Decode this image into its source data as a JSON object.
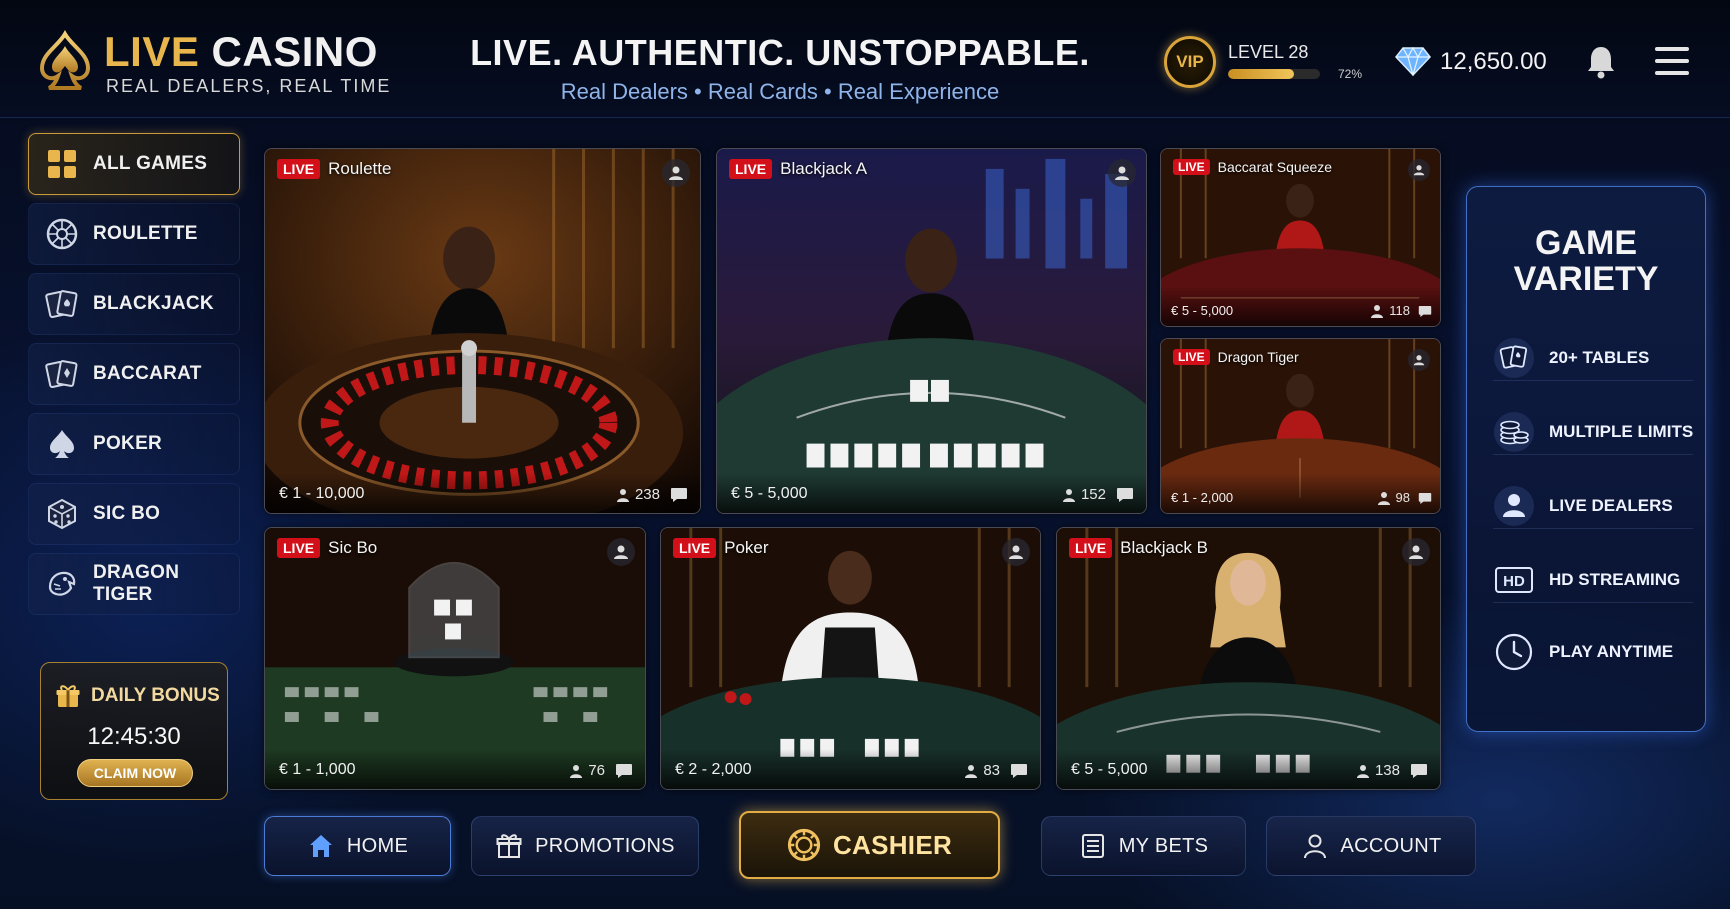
{
  "header": {
    "logo_title_gold": "LIVE",
    "logo_title_white": " CASINO",
    "logo_subtitle": "REAL DEALERS, REAL TIME",
    "tagline": "LIVE. AUTHENTIC. UNSTOPPABLE.",
    "subtagline": "Real Dealers • Real Cards • Real Experience",
    "vip_label": "VIP",
    "level_label": "LEVEL 28",
    "level_progress_pct": 72,
    "level_progress_text": "72%",
    "balance": "12,650.00"
  },
  "sidebar": {
    "items": [
      {
        "label": "ALL GAMES",
        "icon": "grid-icon",
        "active": true
      },
      {
        "label": "ROULETTE",
        "icon": "roulette-icon",
        "active": false
      },
      {
        "label": "BLACKJACK",
        "icon": "cards-icon",
        "active": false
      },
      {
        "label": "BACCARAT",
        "icon": "cards-icon",
        "active": false
      },
      {
        "label": "POKER",
        "icon": "spade-icon",
        "active": false
      },
      {
        "label": "SIC BO",
        "icon": "dice-icon",
        "active": false
      },
      {
        "label": "DRAGON TIGER",
        "icon": "dragon-icon",
        "active": false
      }
    ],
    "bonus": {
      "title": "DAILY BONUS",
      "timer": "12:45:30",
      "button": "CLAIM NOW"
    }
  },
  "games": [
    {
      "live": "LIVE",
      "title": "Roulette",
      "limits": "€ 1 - 10,000",
      "players": "238"
    },
    {
      "live": "LIVE",
      "title": "Blackjack A",
      "limits": "€ 5 - 5,000",
      "players": "152"
    },
    {
      "live": "LIVE",
      "title": "Baccarat Squeeze",
      "limits": "€ 5 - 5,000",
      "players": "118"
    },
    {
      "live": "LIVE",
      "title": "Dragon Tiger",
      "limits": "€ 1 - 2,000",
      "players": "98"
    },
    {
      "live": "LIVE",
      "title": "Sic Bo",
      "limits": "€ 1 - 1,000",
      "players": "76"
    },
    {
      "live": "LIVE",
      "title": "Poker",
      "limits": "€ 2 - 2,000",
      "players": "83"
    },
    {
      "live": "LIVE",
      "title": "Blackjack B",
      "limits": "€ 5 - 5,000",
      "players": "138"
    }
  ],
  "variety": {
    "title_line1": "GAME",
    "title_line2": "VARIETY",
    "items": [
      {
        "label": "20+ TABLES",
        "icon": "cards-icon"
      },
      {
        "label": "MULTIPLE LIMITS",
        "icon": "chips-stack-icon"
      },
      {
        "label": "LIVE DEALERS",
        "icon": "user-icon"
      },
      {
        "label": "HD STREAMING",
        "icon": "hd-icon",
        "badge": "HD"
      },
      {
        "label": "PLAY ANYTIME",
        "icon": "clock-icon"
      }
    ]
  },
  "bottom_nav": {
    "home": "HOME",
    "promotions": "PROMOTIONS",
    "cashier": "CASHIER",
    "my_bets": "MY BETS",
    "account": "ACCOUNT"
  },
  "colors": {
    "gold": "#e8b64c",
    "live_red": "#d3101a",
    "accent_blue": "#5a96ff",
    "background": "#081230"
  }
}
